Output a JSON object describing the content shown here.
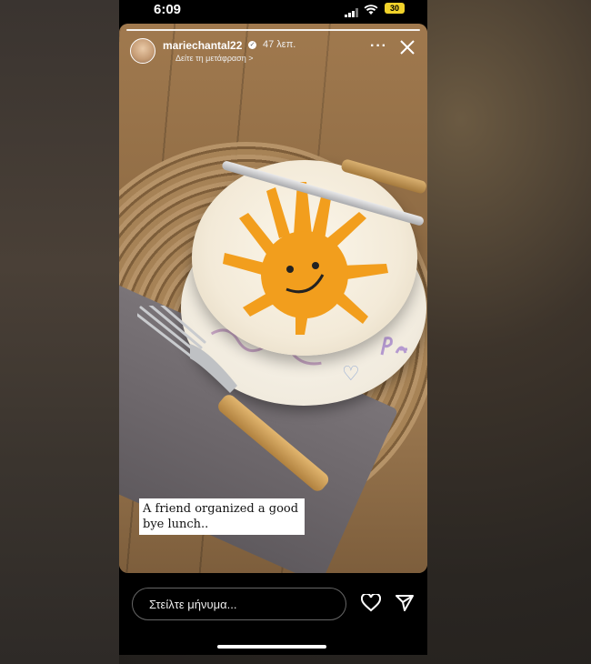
{
  "status_bar": {
    "time": "6:09",
    "battery": "30"
  },
  "story": {
    "username": "mariechantal22",
    "time_ago": "47 λεπ.",
    "translate_link": "Δείτε τη μετάφραση >",
    "caption": "A friend organized a good bye lunch.."
  },
  "message_bar": {
    "placeholder": "Στείλτε μήνυμα..."
  },
  "colors": {
    "sun_orange": "#f29e1d",
    "caption_bg": "#ffffff",
    "battery_yellow": "#f0d22a"
  }
}
